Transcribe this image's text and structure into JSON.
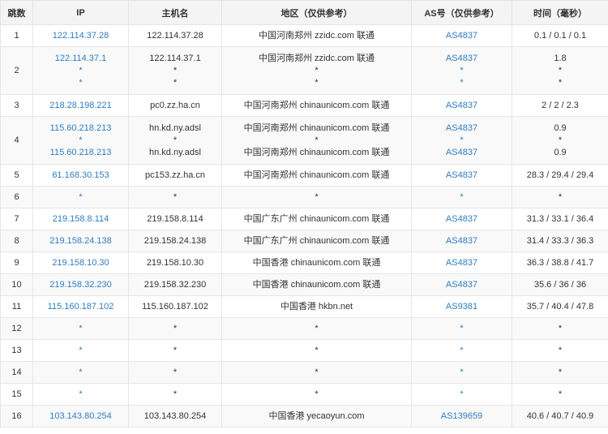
{
  "headers": [
    "跳数",
    "IP",
    "主机名",
    "地区（仅供参考）",
    "AS号（仅供参考）",
    "时间（毫秒）"
  ],
  "rows": [
    {
      "hop": "1",
      "ip": [
        "122.114.37.28"
      ],
      "host": [
        "122.114.37.28"
      ],
      "region": [
        "中国河南郑州 zzidc.com 联通"
      ],
      "as": [
        "AS4837"
      ],
      "time": [
        "0.1 / 0.1 / 0.1"
      ]
    },
    {
      "hop": "2",
      "ip": [
        "122.114.37.1",
        "*",
        "*"
      ],
      "host": [
        "122.114.37.1",
        "*",
        "*"
      ],
      "region": [
        "中国河南郑州 zzidc.com 联通",
        "*",
        "*"
      ],
      "as": [
        "AS4837",
        "*",
        "*"
      ],
      "time": [
        "1.8",
        "*",
        "*"
      ]
    },
    {
      "hop": "3",
      "ip": [
        "218.28.198.221"
      ],
      "host": [
        "pc0.zz.ha.cn"
      ],
      "region": [
        "中国河南郑州 chinaunicom.com 联通"
      ],
      "as": [
        "AS4837"
      ],
      "time": [
        "2 / 2 / 2.3"
      ]
    },
    {
      "hop": "4",
      "ip": [
        "115.60.218.213",
        "*",
        "115.60.218.213"
      ],
      "host": [
        "hn.kd.ny.adsl",
        "*",
        "hn.kd.ny.adsl"
      ],
      "region": [
        "中国河南郑州 chinaunicom.com 联通",
        "*",
        "中国河南郑州 chinaunicom.com 联通"
      ],
      "as": [
        "AS4837",
        "*",
        "AS4837"
      ],
      "time": [
        "0.9",
        "*",
        "0.9"
      ]
    },
    {
      "hop": "5",
      "ip": [
        "61.168.30.153"
      ],
      "host": [
        "pc153.zz.ha.cn"
      ],
      "region": [
        "中国河南郑州 chinaunicom.com 联通"
      ],
      "as": [
        "AS4837"
      ],
      "time": [
        "28.3 / 29.4 / 29.4"
      ]
    },
    {
      "hop": "6",
      "ip": [
        "*"
      ],
      "host": [
        "*"
      ],
      "region": [
        "*"
      ],
      "as": [
        "*"
      ],
      "time": [
        "*"
      ]
    },
    {
      "hop": "7",
      "ip": [
        "219.158.8.114"
      ],
      "host": [
        "219.158.8.114"
      ],
      "region": [
        "中国广东广州 chinaunicom.com 联通"
      ],
      "as": [
        "AS4837"
      ],
      "time": [
        "31.3 / 33.1 / 36.4"
      ]
    },
    {
      "hop": "8",
      "ip": [
        "219.158.24.138"
      ],
      "host": [
        "219.158.24.138"
      ],
      "region": [
        "中国广东广州 chinaunicom.com 联通"
      ],
      "as": [
        "AS4837"
      ],
      "time": [
        "31.4 / 33.3 / 36.3"
      ]
    },
    {
      "hop": "9",
      "ip": [
        "219.158.10.30"
      ],
      "host": [
        "219.158.10.30"
      ],
      "region": [
        "中国香港 chinaunicom.com 联通"
      ],
      "as": [
        "AS4837"
      ],
      "time": [
        "36.3 / 38.8 / 41.7"
      ]
    },
    {
      "hop": "10",
      "ip": [
        "219.158.32.230"
      ],
      "host": [
        "219.158.32.230"
      ],
      "region": [
        "中国香港 chinaunicom.com 联通"
      ],
      "as": [
        "AS4837"
      ],
      "time": [
        "35.6 / 36 / 36"
      ]
    },
    {
      "hop": "11",
      "ip": [
        "115.160.187.102"
      ],
      "host": [
        "115.160.187.102"
      ],
      "region": [
        "中国香港 hkbn.net"
      ],
      "as": [
        "AS9381"
      ],
      "time": [
        "35.7 / 40.4 / 47.8"
      ]
    },
    {
      "hop": "12",
      "ip": [
        "*"
      ],
      "host": [
        "*"
      ],
      "region": [
        "*"
      ],
      "as": [
        "*"
      ],
      "time": [
        "*"
      ]
    },
    {
      "hop": "13",
      "ip": [
        "*"
      ],
      "host": [
        "*"
      ],
      "region": [
        "*"
      ],
      "as": [
        "*"
      ],
      "time": [
        "*"
      ]
    },
    {
      "hop": "14",
      "ip": [
        "*"
      ],
      "host": [
        "*"
      ],
      "region": [
        "*"
      ],
      "as": [
        "*"
      ],
      "time": [
        "*"
      ]
    },
    {
      "hop": "15",
      "ip": [
        "*"
      ],
      "host": [
        "*"
      ],
      "region": [
        "*"
      ],
      "as": [
        "*"
      ],
      "time": [
        "*"
      ]
    },
    {
      "hop": "16",
      "ip": [
        "103.143.80.254"
      ],
      "host": [
        "103.143.80.254"
      ],
      "region": [
        "中国香港 yecaoyun.com"
      ],
      "as": [
        "AS139659"
      ],
      "time": [
        "40.6 / 40.7 / 40.9"
      ]
    }
  ],
  "colors": {
    "link": "#2f7cc1",
    "header_bg": "#f4f4f4",
    "row_alt_bg": "#f9f9f9",
    "border": "#e6e6e6"
  }
}
